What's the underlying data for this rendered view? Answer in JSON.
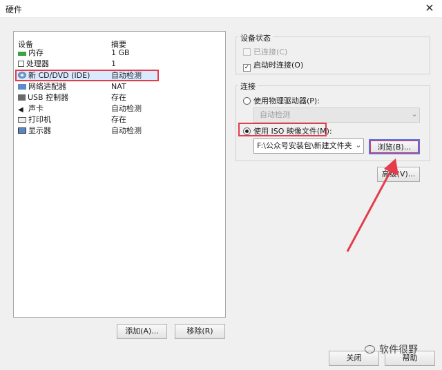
{
  "window": {
    "title": "硬件"
  },
  "device_list": {
    "headers": {
      "device": "设备",
      "summary": "摘要"
    },
    "rows": [
      {
        "device": "内存",
        "summary": "1 GB",
        "icon": "memory-icon"
      },
      {
        "device": "处理器",
        "summary": "1",
        "icon": "processor-icon"
      },
      {
        "device": "新 CD/DVD (IDE)",
        "summary": "自动检测",
        "icon": "cd-dvd-icon"
      },
      {
        "device": "网络适配器",
        "summary": "NAT",
        "icon": "network-adapter-icon"
      },
      {
        "device": "USB 控制器",
        "summary": "存在",
        "icon": "usb-icon"
      },
      {
        "device": "声卡",
        "summary": "自动检测",
        "icon": "speaker-icon"
      },
      {
        "device": "打印机",
        "summary": "存在",
        "icon": "printer-icon"
      },
      {
        "device": "显示器",
        "summary": "自动检测",
        "icon": "monitor-icon"
      }
    ]
  },
  "buttons": {
    "add": "添加(A)...",
    "remove": "移除(R)",
    "close": "关闭",
    "help": "帮助",
    "browse": "浏览(B)...",
    "advanced": "高级(V)..."
  },
  "device_status": {
    "label": "设备状态",
    "connected": "已连接(C)",
    "connect_on_power": "启动时连接(O)"
  },
  "connection": {
    "label": "连接",
    "physical_drive": "使用物理驱动器(P):",
    "drive_value": "自动检测",
    "iso_image": "使用 ISO 映像文件(M):",
    "iso_path": "F:\\公众号安装包\\新建文件夹"
  },
  "watermark": "软件很野",
  "colors": {
    "highlight": "#e43c4b",
    "focus": "#5a6ee8"
  }
}
